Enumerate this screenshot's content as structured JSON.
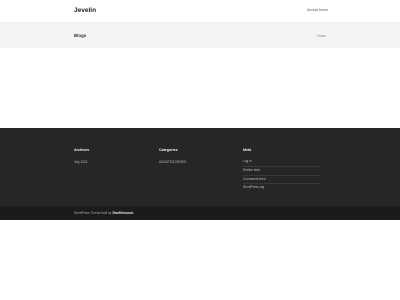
{
  "header": {
    "logo": "Jevelin",
    "nav_link": "Accept terms"
  },
  "title_bar": {
    "title": "Blogs",
    "breadcrumb": "Home"
  },
  "footer": {
    "archives": {
      "title": "Archives",
      "items": [
        "July 2021"
      ]
    },
    "categories": {
      "title": "Categories",
      "items": [
        "UNCATEGORIZED"
      ]
    },
    "meta": {
      "title": "Meta",
      "items": [
        "Log in",
        "Entries feed",
        "Comments feed",
        "WordPress.org"
      ]
    }
  },
  "sub_footer": {
    "prefix": "WordPress Theme built by",
    "author": "Shufflehound."
  },
  "colors": {
    "footer_bg": "#262626",
    "sub_footer_bg": "#1b1b1b",
    "title_bar_bg": "#f4f4f4"
  }
}
